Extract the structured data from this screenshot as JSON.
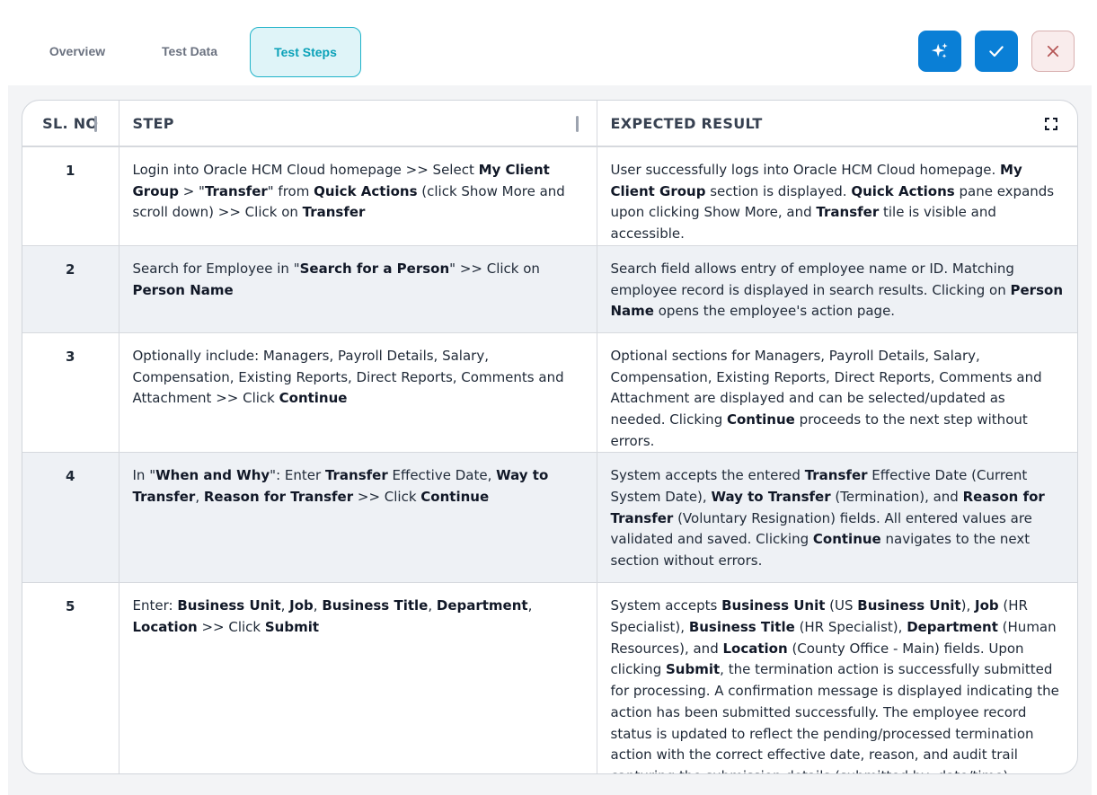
{
  "tabs": [
    {
      "label": "Overview"
    },
    {
      "label": "Test Data"
    },
    {
      "label": "Test Steps"
    }
  ],
  "active_tab": "Test Steps",
  "toolbar": {
    "ai_icon": "sparkle-icon",
    "confirm_icon": "check-icon",
    "close_icon": "close-icon"
  },
  "colors": {
    "accent": "#0a7fd6",
    "tab_active": "#0aa1b8",
    "row_alt": "#eef1f5",
    "close": "#b45454"
  },
  "table": {
    "headers": [
      "SL. NO",
      "STEP",
      "EXPECTED RESULT"
    ],
    "expand_icon": "expand-icon",
    "rows": [
      {
        "num": "1",
        "step": [
          {
            "t": "Login into Oracle HCM Cloud homepage >> Select "
          },
          {
            "t": "My Client Group",
            "b": true
          },
          {
            "t": " > \""
          },
          {
            "t": "Transfer",
            "b": true
          },
          {
            "t": "\" from "
          },
          {
            "t": "Quick Actions",
            "b": true
          },
          {
            "t": " (click Show More and scroll down) >> Click on "
          },
          {
            "t": "Transfer",
            "b": true
          }
        ],
        "result": [
          {
            "t": "User successfully logs into Oracle HCM Cloud homepage. "
          },
          {
            "t": "My Client Group",
            "b": true
          },
          {
            "t": " section is displayed. "
          },
          {
            "t": "Quick Actions",
            "b": true
          },
          {
            "t": " pane expands upon clicking Show More, and "
          },
          {
            "t": "Transfer",
            "b": true
          },
          {
            "t": " tile is visible and accessible."
          }
        ]
      },
      {
        "num": "2",
        "step": [
          {
            "t": "Search for Employee in \""
          },
          {
            "t": "Search for a Person",
            "b": true
          },
          {
            "t": "\" >> Click on "
          },
          {
            "t": "Person Name",
            "b": true
          }
        ],
        "result": [
          {
            "t": "Search field allows entry of employee name or ID. Matching employee record is displayed in search results. Clicking on "
          },
          {
            "t": "Person Name",
            "b": true
          },
          {
            "t": " opens the employee's action page."
          }
        ]
      },
      {
        "num": "3",
        "step": [
          {
            "t": "Optionally include: Managers, Payroll Details, Salary, Compensation, Existing Reports, Direct Reports, Comments and Attachment >> Click "
          },
          {
            "t": "Continue",
            "b": true
          }
        ],
        "result": [
          {
            "t": "Optional sections for Managers, Payroll Details, Salary, Compensation, Existing Reports, Direct Reports, Comments and Attachment are displayed and can be selected/updated as needed. Clicking "
          },
          {
            "t": "Continue",
            "b": true
          },
          {
            "t": " proceeds to the next step without errors."
          }
        ]
      },
      {
        "num": "4",
        "step": [
          {
            "t": "In \""
          },
          {
            "t": "When and Why",
            "b": true
          },
          {
            "t": "\": Enter "
          },
          {
            "t": "Transfer",
            "b": true
          },
          {
            "t": " Effective Date, "
          },
          {
            "t": "Way to Transfer",
            "b": true
          },
          {
            "t": ", "
          },
          {
            "t": "Reason for Transfer",
            "b": true
          },
          {
            "t": " >> Click "
          },
          {
            "t": "Continue",
            "b": true
          }
        ],
        "result": [
          {
            "t": "System accepts the entered "
          },
          {
            "t": "Transfer",
            "b": true
          },
          {
            "t": " Effective Date (Current System Date), "
          },
          {
            "t": "Way to Transfer",
            "b": true
          },
          {
            "t": " (Termination), and "
          },
          {
            "t": "Reason for Transfer",
            "b": true
          },
          {
            "t": " (Voluntary Resignation) fields. All entered values are validated and saved. Clicking "
          },
          {
            "t": "Continue",
            "b": true
          },
          {
            "t": " navigates to the next section without errors."
          }
        ]
      },
      {
        "num": "5",
        "step": [
          {
            "t": "Enter: "
          },
          {
            "t": "Business Unit",
            "b": true
          },
          {
            "t": ", "
          },
          {
            "t": "Job",
            "b": true
          },
          {
            "t": ", "
          },
          {
            "t": "Business Title",
            "b": true
          },
          {
            "t": ", "
          },
          {
            "t": "Department",
            "b": true
          },
          {
            "t": ", "
          },
          {
            "t": "Location",
            "b": true
          },
          {
            "t": " >> Click "
          },
          {
            "t": "Submit",
            "b": true
          }
        ],
        "result": [
          {
            "t": "System accepts "
          },
          {
            "t": "Business Unit",
            "b": true
          },
          {
            "t": " (US "
          },
          {
            "t": "Business Unit",
            "b": true
          },
          {
            "t": "), "
          },
          {
            "t": "Job",
            "b": true
          },
          {
            "t": " (HR Specialist), "
          },
          {
            "t": "Business Title",
            "b": true
          },
          {
            "t": " (HR Specialist), "
          },
          {
            "t": "Department",
            "b": true
          },
          {
            "t": " (Human Resources), and "
          },
          {
            "t": "Location",
            "b": true
          },
          {
            "t": " (County Office - Main) fields. Upon clicking "
          },
          {
            "t": "Submit",
            "b": true
          },
          {
            "t": ", the termination action is successfully submitted for processing. A confirmation message is displayed indicating the action has been submitted successfully. The employee record status is updated to reflect the pending/processed termination action with the correct effective date, reason, and audit trail capturing the submission details (submitted by, date/time)."
          }
        ]
      }
    ]
  }
}
